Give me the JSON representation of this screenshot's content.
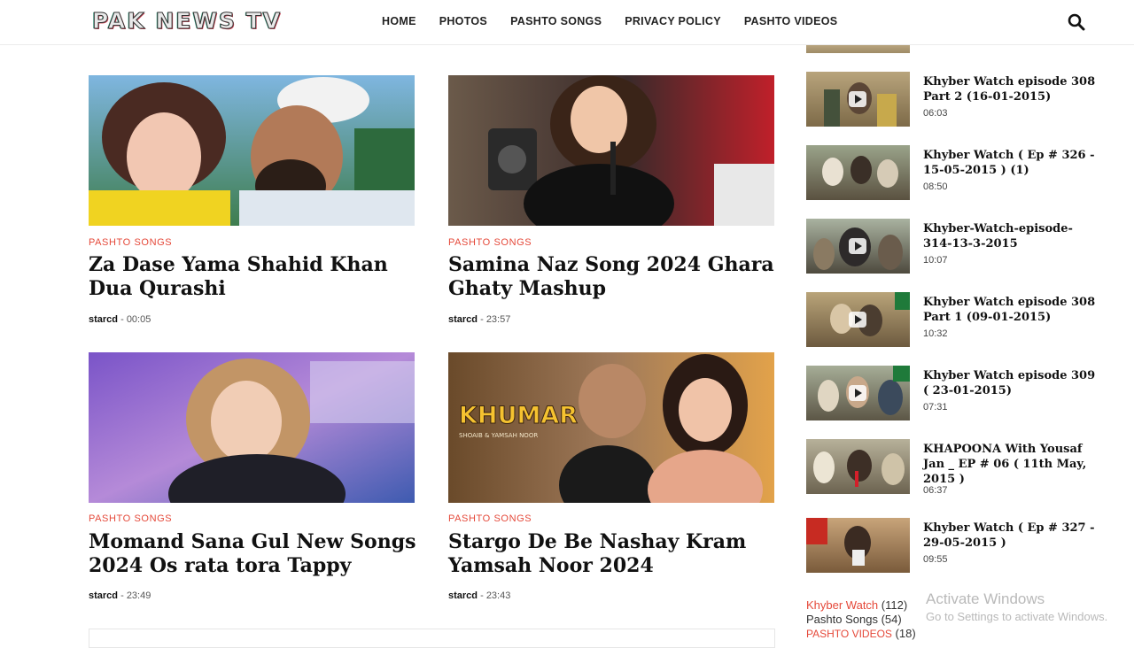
{
  "site": {
    "logo": "PAK NEWS TV"
  },
  "nav": {
    "items": [
      "HOME",
      "PHOTOS",
      "PASHTO SONGS",
      "PRIVACY POLICY",
      "PASHTO VIDEOS"
    ]
  },
  "posts": [
    {
      "category": "PASHTO SONGS",
      "title": "Za Dase Yama Shahid Khan Dua Qurashi",
      "author": "starcd",
      "sep": " - ",
      "time": "00:05"
    },
    {
      "category": "PASHTO SONGS",
      "title": "Samina Naz Song 2024 Ghara Ghaty Mashup",
      "author": "starcd",
      "sep": " - ",
      "time": "23:57"
    },
    {
      "category": "PASHTO SONGS",
      "title": "Momand Sana Gul New Songs 2024 Os rata tora Tappy",
      "author": "starcd",
      "sep": " - ",
      "time": "23:49"
    },
    {
      "category": "PASHTO SONGS",
      "title": "Stargo De Be Nashay Kram Yamsah Noor 2024",
      "author": "starcd",
      "sep": " - ",
      "time": "23:43"
    }
  ],
  "thumb_text": {
    "khumar": "KHUMAR",
    "khumar_sub": "SHOAIB & YAMSAH NOOR"
  },
  "sidebar": {
    "items": [
      {
        "title": "Khyber Watch episode 308 Part 2 (16-01-2015)",
        "duration": "06:03"
      },
      {
        "title": "Khyber Watch ( Ep # 326 - 15-05-2015 ) (1)",
        "duration": "08:50"
      },
      {
        "title": "Khyber-Watch-episode-314-13-3-2015",
        "duration": "10:07"
      },
      {
        "title": "Khyber Watch episode 308 Part 1 (09-01-2015)",
        "duration": "10:32"
      },
      {
        "title": "Khyber Watch episode 309 ( 23-01-2015)",
        "duration": "07:31"
      },
      {
        "title": "KHAPOONA With Yousaf Jan _ EP # 06 ( 11th May, 2015 )",
        "duration": "06:37"
      },
      {
        "title": "Khyber Watch ( Ep # 327 - 29-05-2015 )",
        "duration": "09:55"
      }
    ],
    "labels": [
      {
        "name": "Khyber Watch",
        "count": "(112)"
      },
      {
        "name": "Pashto Songs",
        "count": "(54)"
      },
      {
        "name": "PASHTO VIDEOS",
        "count": "(18)"
      }
    ]
  },
  "watermark": {
    "line1": "Activate Windows",
    "line2": "Go to Settings to activate Windows."
  },
  "colors": {
    "accent": "#e5493a"
  }
}
